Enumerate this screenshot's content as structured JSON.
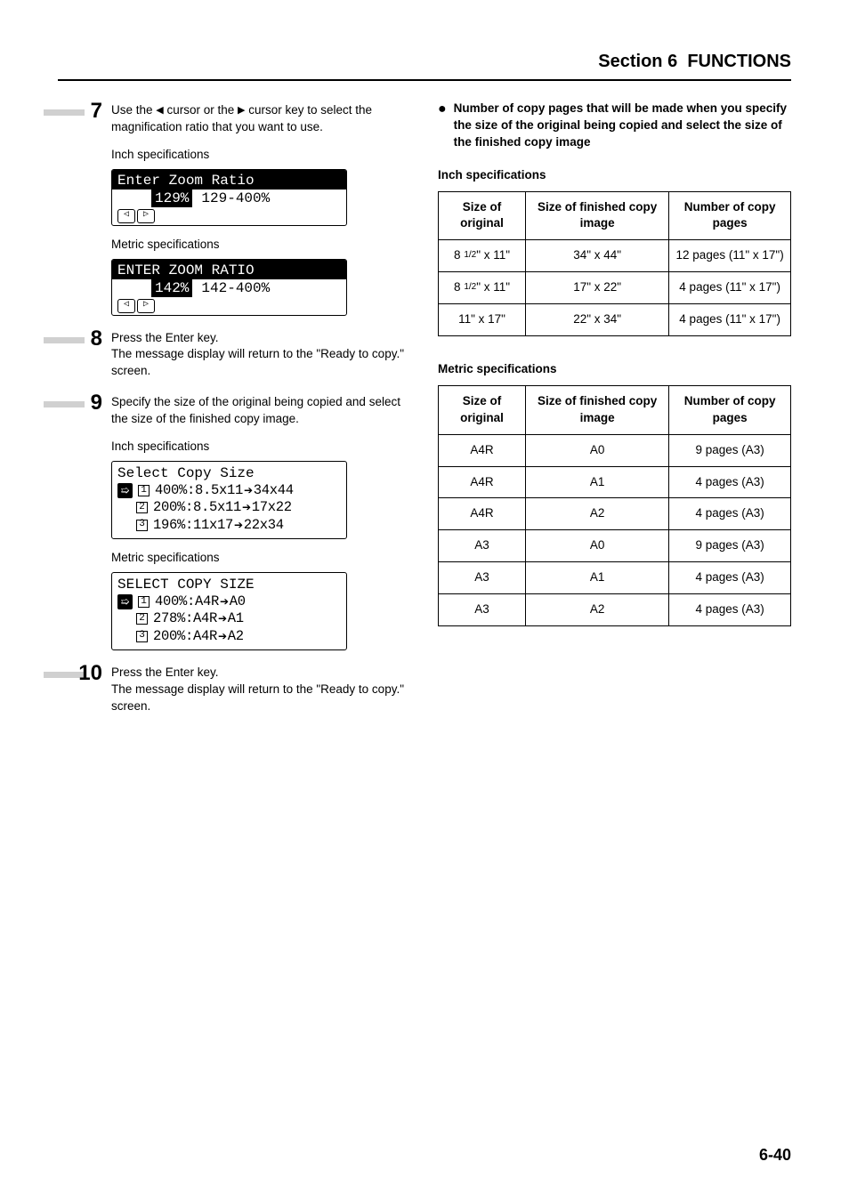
{
  "header": {
    "section": "Section 6",
    "title": "FUNCTIONS"
  },
  "left": {
    "step7": {
      "num": "7",
      "text_pre": "Use the ",
      "text_mid": " cursor or the ",
      "text_post": " cursor key to select the magnification ratio that you want to use.",
      "inch_label": "Inch specifications",
      "inch_lcd_title": "Enter Zoom Ratio",
      "inch_lcd_val": "129%",
      "inch_lcd_range": "129-400%",
      "metric_label": "Metric specifications",
      "metric_lcd_title": "ENTER ZOOM RATIO",
      "metric_lcd_val": "142%",
      "metric_lcd_range": "142-400%"
    },
    "step8": {
      "num": "8",
      "line1": "Press the Enter key.",
      "line2": "The message display will return to the \"Ready to copy.\" screen."
    },
    "step9": {
      "num": "9",
      "text": "Specify the size of the original being copied and select the size of the finished copy image.",
      "inch_label": "Inch specifications",
      "inch_lcd_title": "Select Copy Size",
      "inch_rows": [
        {
          "n": "1",
          "t1": "400%:8.5x11",
          "t2": "34x44"
        },
        {
          "n": "2",
          "t1": "200%:8.5x11",
          "t2": "17x22"
        },
        {
          "n": "3",
          "t1": "196%:11x17",
          "t2": "22x34"
        }
      ],
      "metric_label": "Metric specifications",
      "metric_lcd_title": "SELECT COPY SIZE",
      "metric_rows": [
        {
          "n": "1",
          "t1": "400%:A4R",
          "t2": "A0"
        },
        {
          "n": "2",
          "t1": "278%:A4R",
          "t2": "A1"
        },
        {
          "n": "3",
          "t1": "200%:A4R",
          "t2": "A2"
        }
      ]
    },
    "step10": {
      "num": "10",
      "line1": "Press the Enter key.",
      "line2": "The message display will return to the \"Ready to copy.\" screen."
    }
  },
  "right": {
    "bullet": "Number of copy pages that will be made when you specify the size of the original being copied and select the size of the finished copy image",
    "inch_label": "Inch specifications",
    "inch_headers": [
      "Size of original",
      "Size of finished copy image",
      "Number of copy pages"
    ],
    "inch_rows": [
      {
        "orig_a": "8",
        "orig_f": "1/2",
        "orig_b": "\" x 11\"",
        "fin": "34\" x 44\"",
        "pg": "12 pages (11\" x 17\")"
      },
      {
        "orig_a": "8",
        "orig_f": "1/2",
        "orig_b": "\" x 11\"",
        "fin": "17\" x 22\"",
        "pg": "4 pages (11\" x 17\")"
      },
      {
        "orig_a": "11\" x 17\"",
        "orig_f": "",
        "orig_b": "",
        "fin": "22\" x 34\"",
        "pg": "4 pages (11\" x 17\")"
      }
    ],
    "metric_label": "Metric specifications",
    "metric_headers": [
      "Size of original",
      "Size of finished copy image",
      "Number of copy pages"
    ],
    "metric_rows": [
      {
        "orig": "A4R",
        "fin": "A0",
        "pg": "9 pages (A3)"
      },
      {
        "orig": "A4R",
        "fin": "A1",
        "pg": "4 pages (A3)"
      },
      {
        "orig": "A4R",
        "fin": "A2",
        "pg": "4 pages (A3)"
      },
      {
        "orig": "A3",
        "fin": "A0",
        "pg": "9 pages (A3)"
      },
      {
        "orig": "A3",
        "fin": "A1",
        "pg": "4 pages (A3)"
      },
      {
        "orig": "A3",
        "fin": "A2",
        "pg": "4 pages (A3)"
      }
    ]
  },
  "page_number": "6-40"
}
